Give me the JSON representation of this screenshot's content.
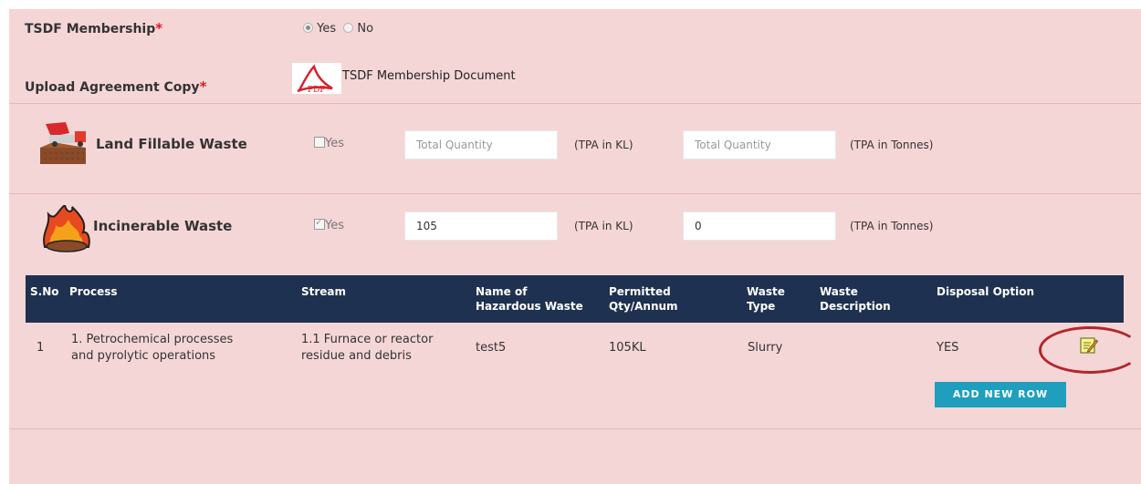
{
  "membership": {
    "label": "TSDF Membership",
    "required": "*",
    "options": [
      "Yes",
      "No"
    ],
    "selected": "Yes"
  },
  "upload": {
    "label": "Upload Agreement Copy",
    "required": "*",
    "pdf_icon_text": "PDF",
    "document_link": "TSDF Membership Document"
  },
  "waste_types": [
    {
      "label": "Land Fillable Waste",
      "checkbox_label": "Yes",
      "checked": false,
      "qty_kl": "",
      "qty_kl_placeholder": "Total Quantity",
      "unit_kl": "(TPA in KL)",
      "qty_tonnes": "",
      "qty_tonnes_placeholder": "Total Quantity",
      "unit_tonnes": "(TPA in Tonnes)"
    },
    {
      "label": "Incinerable Waste",
      "checkbox_label": "Yes",
      "checked": true,
      "qty_kl": "105",
      "qty_kl_placeholder": "",
      "unit_kl": "(TPA in KL)",
      "qty_tonnes": "0",
      "qty_tonnes_placeholder": "",
      "unit_tonnes": "(TPA in Tonnes)"
    }
  ],
  "table": {
    "headers": {
      "sno": "S.No",
      "process": "Process",
      "stream": "Stream",
      "name1": "Name of",
      "name2": "Hazardous Waste",
      "perm1": "Permitted",
      "perm2": "Qty/Annum",
      "type1": "Waste",
      "type2": "Type",
      "desc1": "Waste",
      "desc2": "Description",
      "disposal": "Disposal Option"
    },
    "rows": [
      {
        "sno": "1",
        "process1": "1. Petrochemical processes",
        "process2": "and pyrolytic operations",
        "stream1": "1.1 Furnace or reactor",
        "stream2": "residue and debris",
        "name": "test5",
        "permitted": "105KL",
        "type": "Slurry",
        "description": "",
        "disposal": "YES"
      }
    ],
    "add_button": "ADD NEW ROW"
  },
  "colors": {
    "panel": "#f5d6d6",
    "header": "#1f3150",
    "button": "#1f9fbd",
    "required": "#e1191b",
    "highlight_ring": "#b3262e"
  }
}
